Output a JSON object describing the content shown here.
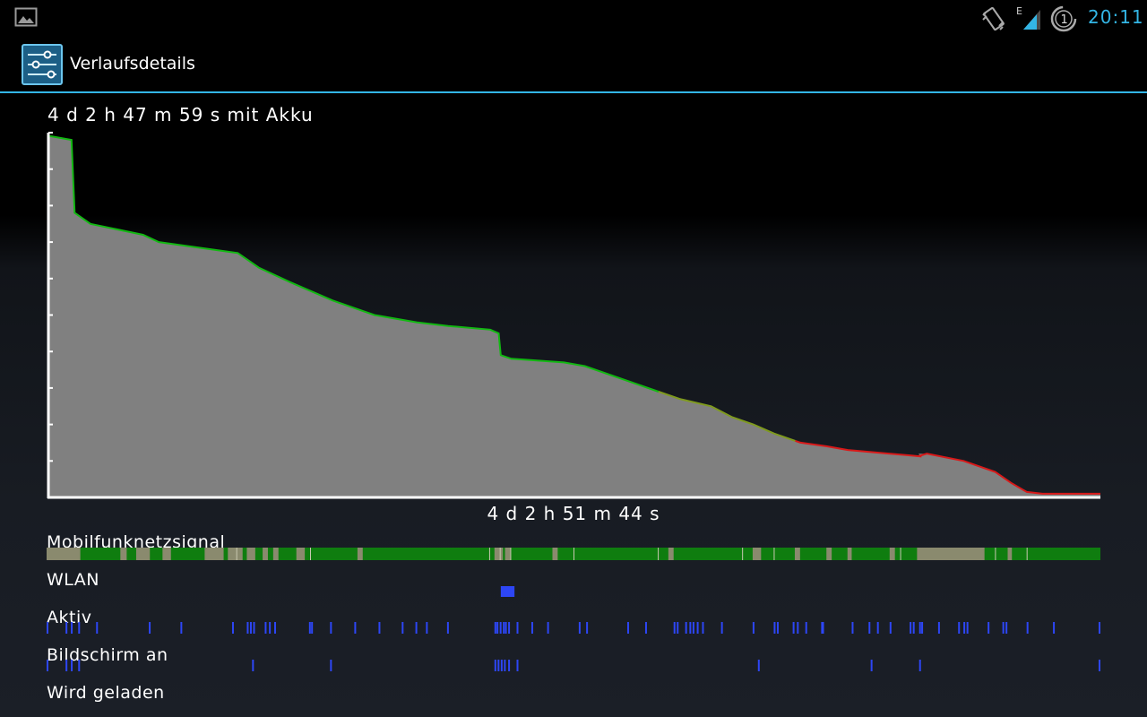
{
  "status_bar": {
    "time": "20:11",
    "network_type": "E",
    "sync_badge": "1",
    "icons": [
      "gallery-icon",
      "vibrate-icon",
      "signal-icon",
      "sync-icon"
    ],
    "clock_color": "#33b5e5"
  },
  "action_bar": {
    "title": "Verlaufsdetails",
    "icon": "settings-sliders-icon",
    "accent": "#33b5e5"
  },
  "battery": {
    "runtime_label": "4 d 2 h 47 m 59 s mit Akku",
    "total_duration_label": "4 d 2 h 51 m 44 s"
  },
  "chart_data": {
    "type": "area",
    "title": "4 d 2 h 47 m 59 s mit Akku",
    "xlabel": "4 d 2 h 51 m 44 s",
    "ylabel": "",
    "xlim": [
      0,
      1
    ],
    "ylim": [
      0,
      100
    ],
    "fill_color": "#808080",
    "series": [
      {
        "x": [
          0.0,
          0.003,
          0.022,
          0.025,
          0.04,
          0.09,
          0.105,
          0.18,
          0.19,
          0.2,
          0.23,
          0.27,
          0.3,
          0.31,
          0.35,
          0.38,
          0.42,
          0.428,
          0.43,
          0.44,
          0.49,
          0.51,
          0.56,
          0.6,
          0.63,
          0.65,
          0.67,
          0.69,
          0.715,
          0.74,
          0.76,
          0.8,
          0.82,
          0.83,
          0.827,
          0.835,
          0.87,
          0.9,
          0.915,
          0.93,
          0.945,
          1.0
        ],
        "y": [
          99,
          99,
          98,
          78,
          75,
          72,
          70,
          67,
          65,
          63,
          59,
          54,
          51,
          50,
          48,
          47,
          46,
          45,
          39,
          38,
          37,
          36,
          31,
          27,
          25,
          22,
          20,
          17.5,
          15,
          14,
          13,
          12,
          11.5,
          11.2,
          12,
          12,
          10,
          7,
          4,
          1.5,
          1,
          1
        ],
        "line_segments": [
          {
            "from": 0.0,
            "to": 0.58,
            "color": "#12b812"
          },
          {
            "from": 0.58,
            "to": 0.71,
            "color": "#7f9a1f"
          },
          {
            "from": 0.71,
            "to": 1.0,
            "color": "#d81919"
          }
        ]
      }
    ],
    "y_ticks": [
      90,
      80,
      70,
      60,
      50,
      40,
      30,
      20,
      10
    ]
  },
  "signal_rows": [
    {
      "key": "mobile",
      "label": "Mobilfunknetzsignal",
      "kind": "mobile",
      "base_color": "#0f7d0f",
      "weak_color": "#8a8a6e",
      "weak_segments": [
        [
          0.0,
          0.032
        ],
        [
          0.07,
          0.076
        ],
        [
          0.085,
          0.098
        ],
        [
          0.11,
          0.118
        ],
        [
          0.15,
          0.168
        ],
        [
          0.172,
          0.186
        ],
        [
          0.19,
          0.198
        ],
        [
          0.205,
          0.21
        ],
        [
          0.215,
          0.22
        ],
        [
          0.237,
          0.245
        ],
        [
          0.295,
          0.3
        ],
        [
          0.425,
          0.433
        ],
        [
          0.435,
          0.44
        ],
        [
          0.48,
          0.485
        ],
        [
          0.59,
          0.595
        ],
        [
          0.67,
          0.678
        ],
        [
          0.71,
          0.715
        ],
        [
          0.74,
          0.745
        ],
        [
          0.76,
          0.764
        ],
        [
          0.8,
          0.805
        ],
        [
          0.826,
          0.89
        ],
        [
          0.912,
          0.916
        ]
      ],
      "white_ticks": [
        0.18,
        0.25,
        0.42,
        0.43,
        0.44,
        0.5,
        0.58,
        0.66,
        0.69,
        0.81,
        0.9,
        0.93
      ]
    },
    {
      "key": "wifi",
      "label": "WLAN",
      "kind": "wifi",
      "color": "#2d46f5",
      "segments": [
        [
          0.431,
          0.444
        ]
      ]
    },
    {
      "key": "awake",
      "label": "Aktiv",
      "kind": "bars",
      "color": "#2d46f5",
      "ticks": [
        0.0,
        0.018,
        0.023,
        0.03,
        0.047,
        0.097,
        0.127,
        0.176,
        0.19,
        0.193,
        0.196,
        0.207,
        0.211,
        0.216,
        0.249,
        0.251,
        0.269,
        0.292,
        0.315,
        0.337,
        0.35,
        0.36,
        0.38,
        0.425,
        0.427,
        0.43,
        0.433,
        0.435,
        0.438,
        0.446,
        0.46,
        0.475,
        0.505,
        0.512,
        0.551,
        0.568,
        0.595,
        0.598,
        0.606,
        0.61,
        0.613,
        0.617,
        0.622,
        0.64,
        0.67,
        0.69,
        0.693,
        0.708,
        0.712,
        0.72,
        0.735,
        0.736,
        0.764,
        0.78,
        0.788,
        0.8,
        0.819,
        0.822,
        0.828,
        0.83,
        0.846,
        0.865,
        0.87,
        0.873,
        0.893,
        0.907,
        0.91,
        0.93,
        0.955,
        1.0
      ]
    },
    {
      "key": "screen",
      "label": "Bildschirm an",
      "kind": "bars",
      "color": "#2d46f5",
      "ticks": [
        0.0,
        0.018,
        0.023,
        0.03,
        0.195,
        0.269,
        0.425,
        0.428,
        0.431,
        0.434,
        0.438,
        0.446,
        0.675,
        0.782,
        0.828,
        1.0
      ]
    },
    {
      "key": "charging",
      "label": "Wird geladen",
      "kind": "none"
    }
  ]
}
